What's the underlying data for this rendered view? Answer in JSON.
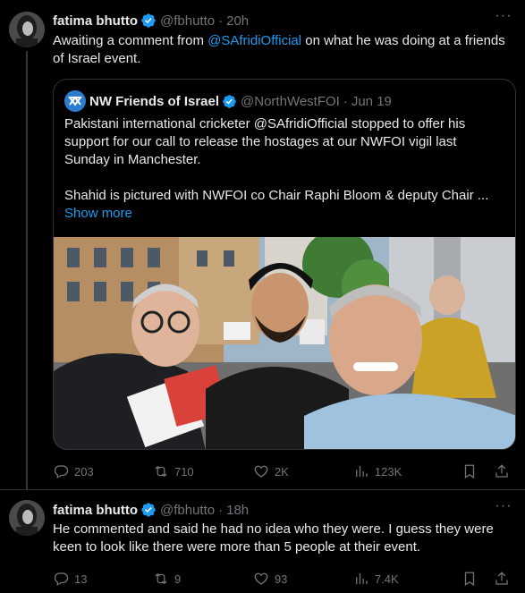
{
  "tweet1": {
    "author_name": "fatima bhutto",
    "handle": "@fbhutto",
    "separator": "·",
    "time": "20h",
    "text_prefix": "Awaiting a comment from ",
    "mention": "@SAfridiOfficial",
    "text_suffix": " on what he was doing at a friends of Israel event.",
    "quoted": {
      "author_name": "NW Friends of Israel",
      "handle": "@NorthWestFOI",
      "separator": "·",
      "time": "Jun 19",
      "paragraph1": "Pakistani international cricketer @SAfridiOfficial stopped to offer his support for our call to release the hostages at our NWFOI vigil last Sunday in Manchester.",
      "paragraph2": "Shahid is pictured with NWFOI co Chair Raphi Bloom & deputy Chair ...",
      "show_more": "Show more"
    },
    "stats": {
      "replies": "203",
      "reposts": "710",
      "likes": "2K",
      "views": "123K"
    }
  },
  "tweet2": {
    "author_name": "fatima bhutto",
    "handle": "@fbhutto",
    "separator": "·",
    "time": "18h",
    "text": "He commented and said he had no idea who they were. I guess they were keen to look like there were more than 5 people at their event.",
    "stats": {
      "replies": "13",
      "reposts": "9",
      "likes": "93",
      "views": "7.4K"
    }
  },
  "colors": {
    "background": "#000000",
    "text_primary": "#e7e9ea",
    "text_secondary": "#71767b",
    "accent": "#1d9bf0",
    "border": "#2f3336"
  },
  "icons": [
    "verified-badge-icon",
    "more-icon",
    "reply-icon",
    "repost-icon",
    "like-icon",
    "views-icon",
    "bookmark-icon",
    "share-icon"
  ]
}
